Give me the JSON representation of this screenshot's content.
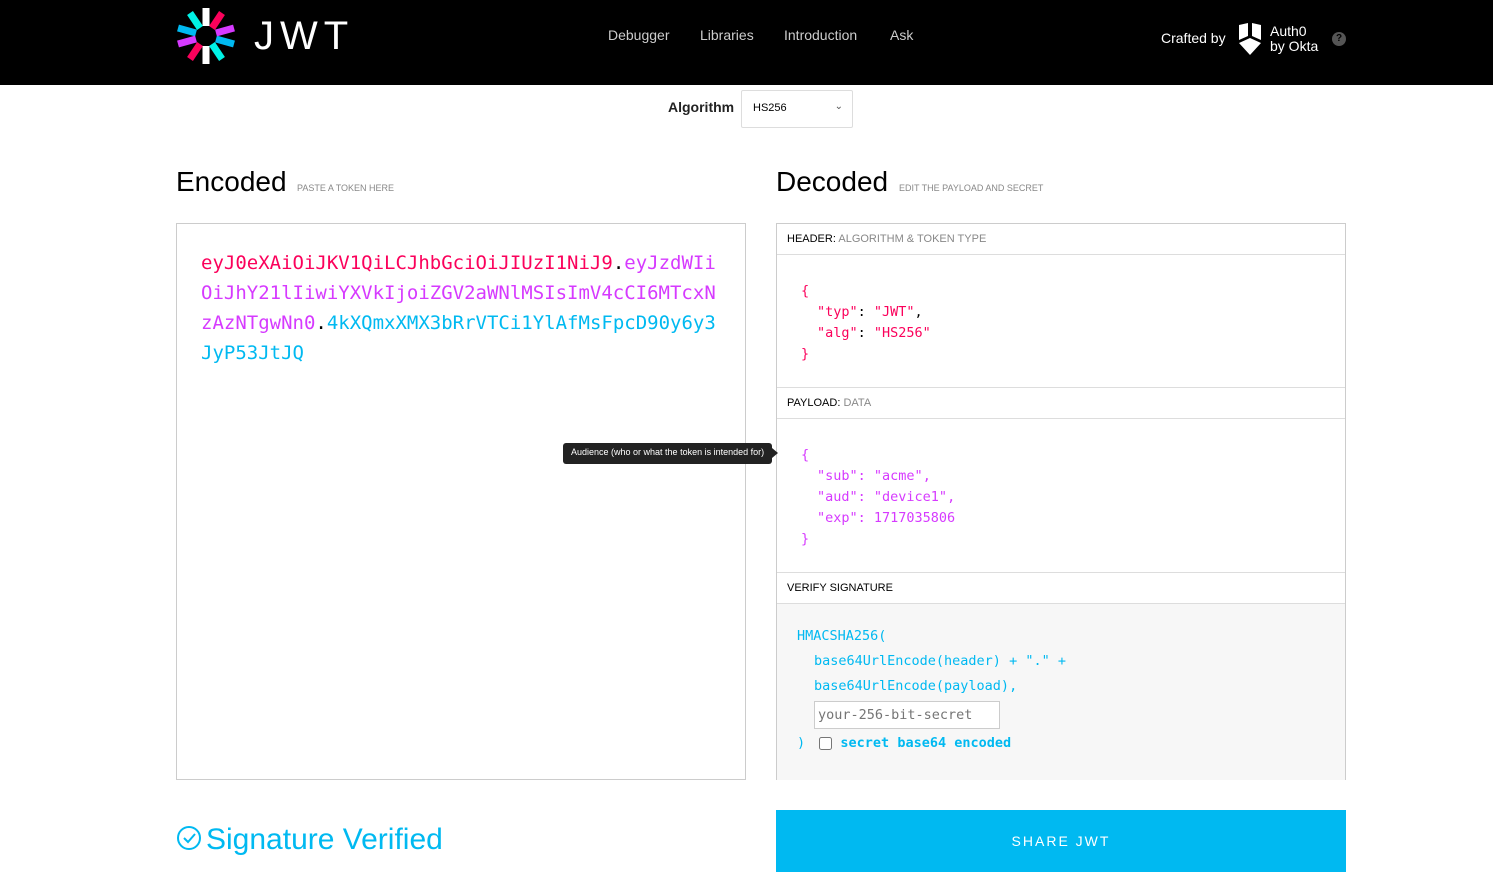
{
  "header": {
    "brand": "JWT",
    "nav": [
      "Debugger",
      "Libraries",
      "Introduction",
      "Ask"
    ],
    "crafted_by": "Crafted by",
    "auth0_line1": "Auth0",
    "auth0_line2": "by Okta",
    "help": "?"
  },
  "algorithm": {
    "label": "Algorithm",
    "value": "HS256"
  },
  "encoded": {
    "title": "Encoded",
    "subtitle": "PASTE A TOKEN HERE",
    "header_part": "eyJ0eXAiOiJKV1QiLCJhbGciOiJIUzI1NiJ9",
    "payload_part": "eyJzdWIiOiJhY21lIiwiYXVkIjoiZGV2aWNlMSIsImV4cCI6MTcxNzAzNTgwNn0",
    "signature_part": "4kXQmxXMX3bRrVTCi1YlAfMsFpcD90y6y3JyP53JtJQ",
    "dot": "."
  },
  "decoded": {
    "title": "Decoded",
    "subtitle": "EDIT THE PAYLOAD AND SECRET",
    "header_label": "HEADER:",
    "header_sub": "ALGORITHM & TOKEN TYPE",
    "header_json": {
      "typ_key": "\"typ\"",
      "typ_val": "\"JWT\"",
      "alg_key": "\"alg\"",
      "alg_val": "\"HS256\""
    },
    "payload_label": "PAYLOAD:",
    "payload_sub": "DATA",
    "payload_json": {
      "sub_key": "\"sub\"",
      "sub_val": "\"acme\"",
      "aud_key": "\"aud\"",
      "aud_val": "\"device1\"",
      "exp_key": "\"exp\"",
      "exp_val": "1717035806"
    },
    "verify_label": "VERIFY SIGNATURE",
    "verify": {
      "line1": "HMACSHA256(",
      "line2": "base64UrlEncode(header) + \".\" +",
      "line3": "base64UrlEncode(payload),",
      "secret_placeholder": "your-256-bit-secret",
      "close": ")",
      "checkbox_label": "secret base64 encoded"
    }
  },
  "tooltip": "Audience (who or what the token is intended for)",
  "status": "Signature Verified",
  "share_button": "SHARE JWT",
  "colors": {
    "header": "#fb015b",
    "payload": "#d63aff",
    "signature": "#00b9f1"
  }
}
